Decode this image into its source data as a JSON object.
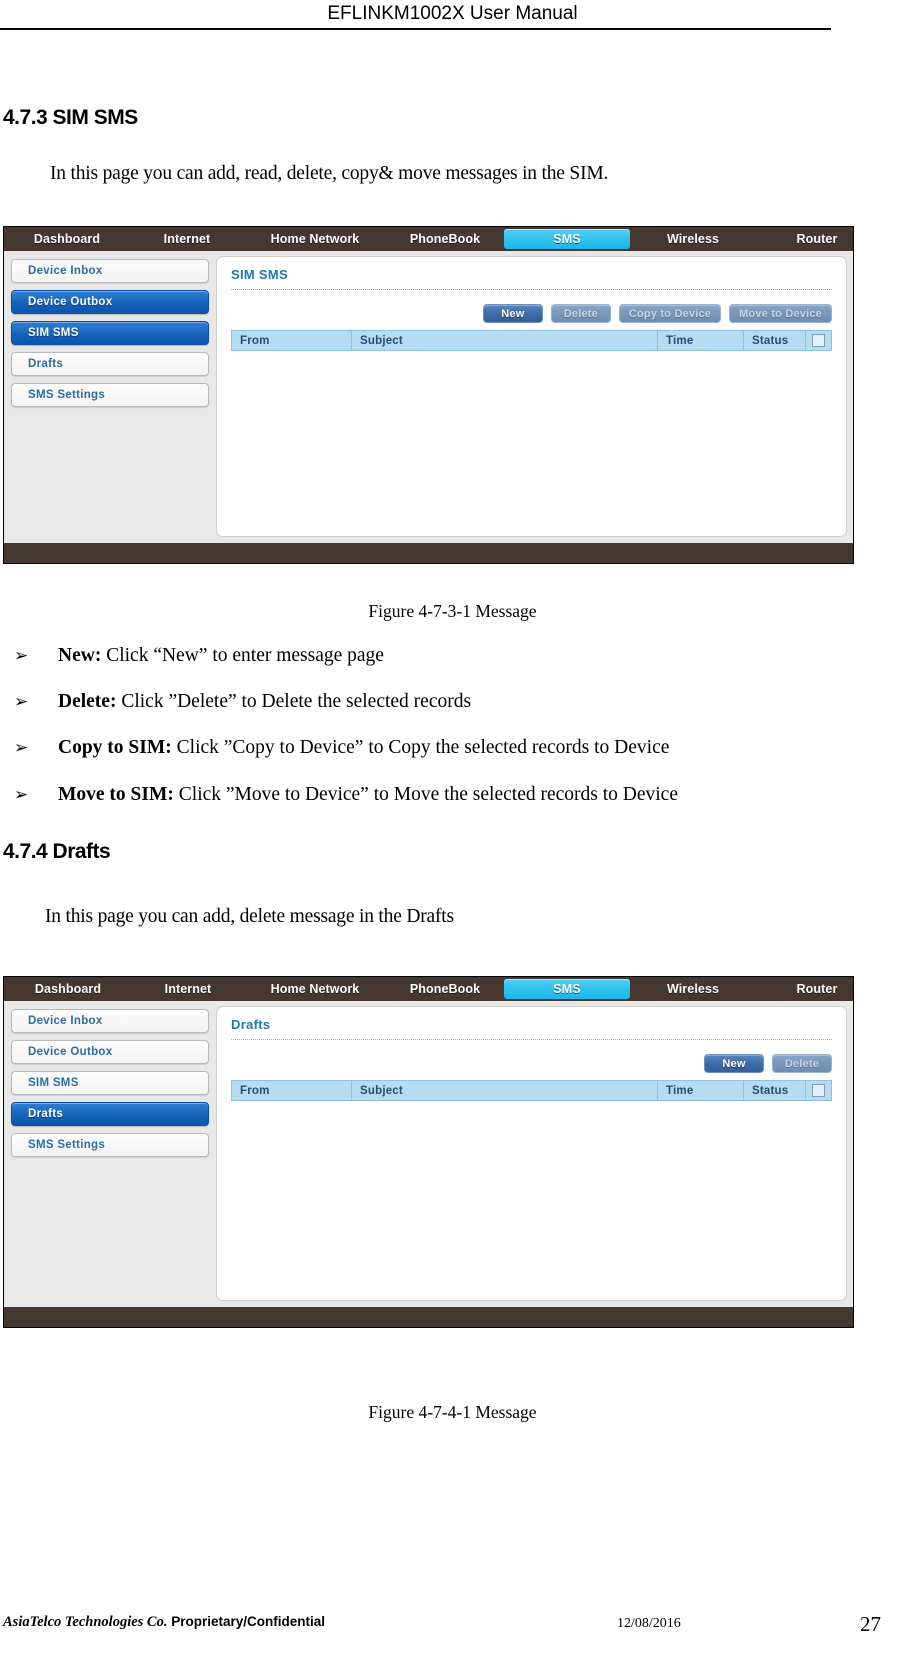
{
  "page_header": {
    "title": "EFLINKM1002X User Manual"
  },
  "sections": [
    {
      "number_title": "4.7.3 SIM SMS",
      "intro": "In this page you can add, read, delete, copy& move messages in the SIM.",
      "caption": "Figure 4-7-3-1 Message"
    },
    {
      "number_title": "4.7.4 Drafts",
      "intro": "In this page you can add, delete message in the Drafts",
      "caption": "Figure 4-7-4-1 Message"
    }
  ],
  "bullets": [
    {
      "term": "New:",
      "text": " Click “New” to enter message page"
    },
    {
      "term": "Delete:",
      "text": " Click ”Delete” to Delete the selected records"
    },
    {
      "term": "Copy to SIM:",
      "text": " Click ”Copy to Device” to Copy the selected records to Device"
    },
    {
      "term": "Move to SIM:",
      "text": " Click ”Move to Device” to Move the selected records to Device"
    }
  ],
  "bullet_glyph": "➢",
  "ui": {
    "nav_tabs": [
      {
        "label": "Dashboard",
        "active": false
      },
      {
        "label": "Internet",
        "active": false
      },
      {
        "label": "Home Network",
        "active": false
      },
      {
        "label": "PhoneBook",
        "active": false
      },
      {
        "label": "SMS",
        "active": true
      },
      {
        "label": "Wireless",
        "active": false
      },
      {
        "label": "Router",
        "active": false
      }
    ],
    "table_headers": {
      "from": "From",
      "subject": "Subject",
      "time": "Time",
      "status": "Status",
      "select_all": "select-all-checkbox"
    },
    "colors": {
      "navbar": "#463830",
      "active_tab": "#35c3ef",
      "sidebar_active": "#1663bb",
      "panel_title": "#2277bb",
      "table_header": "#b6dcf2"
    },
    "screen_sim_sms": {
      "sidebar": [
        {
          "label": "Device Inbox",
          "active": false
        },
        {
          "label": "Device Outbox",
          "active": true
        },
        {
          "label": "SIM SMS",
          "active": true
        },
        {
          "label": "Drafts",
          "active": false
        },
        {
          "label": "SMS Settings",
          "active": false
        }
      ],
      "panel_title": "SIM SMS",
      "buttons": [
        {
          "label": "New",
          "enabled": true
        },
        {
          "label": "Delete",
          "enabled": false
        },
        {
          "label": "Copy to Device",
          "enabled": false
        },
        {
          "label": "Move to Device",
          "enabled": false
        }
      ]
    },
    "screen_drafts": {
      "sidebar": [
        {
          "label": "Device Inbox",
          "active": false
        },
        {
          "label": "Device Outbox",
          "active": false
        },
        {
          "label": "SIM SMS",
          "active": false
        },
        {
          "label": "Drafts",
          "active": true
        },
        {
          "label": "SMS Settings",
          "active": false
        }
      ],
      "panel_title": "Drafts",
      "buttons": [
        {
          "label": "New",
          "enabled": true
        },
        {
          "label": "Delete",
          "enabled": false
        }
      ]
    }
  },
  "doc_footer": {
    "company_italic": "AsiaTelco Technologies Co.",
    "company_rest": " Proprietary/Confidential",
    "date": "12/08/2016",
    "page_number": "27"
  }
}
